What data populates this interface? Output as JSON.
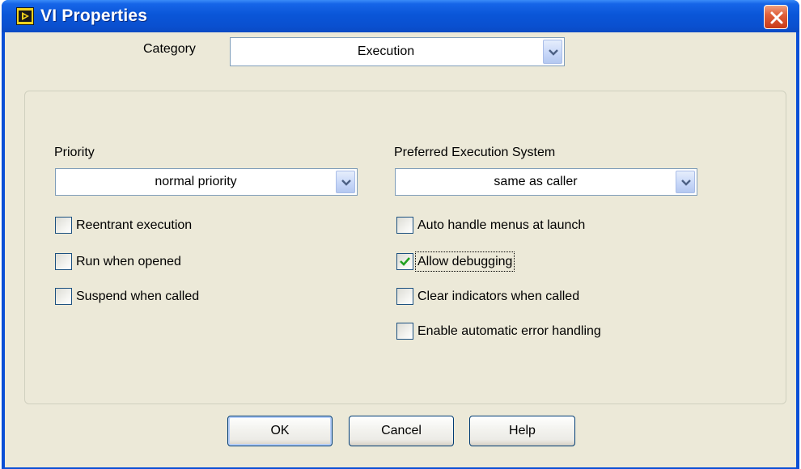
{
  "window": {
    "title": "VI Properties",
    "icon": "labview-vi-icon",
    "close_icon": "close-x-icon"
  },
  "category": {
    "label": "Category",
    "value": "Execution"
  },
  "priority": {
    "label": "Priority",
    "value": "normal priority"
  },
  "execution_system": {
    "label": "Preferred Execution System",
    "value": "same as caller"
  },
  "left_options": [
    {
      "label": "Reentrant execution",
      "checked": false
    },
    {
      "label": "Run when opened",
      "checked": false
    },
    {
      "label": "Suspend when called",
      "checked": false
    }
  ],
  "right_options": [
    {
      "label": "Auto handle menus at launch",
      "checked": false
    },
    {
      "label": "Allow debugging",
      "checked": true
    },
    {
      "label": "Clear indicators when called",
      "checked": false
    },
    {
      "label": "Enable automatic error handling",
      "checked": false
    }
  ],
  "buttons": {
    "ok": "OK",
    "cancel": "Cancel",
    "help": "Help"
  },
  "colors": {
    "titlebar": "#0a56d8",
    "client_bg": "#ece9d8",
    "check_mark": "#21a121"
  }
}
